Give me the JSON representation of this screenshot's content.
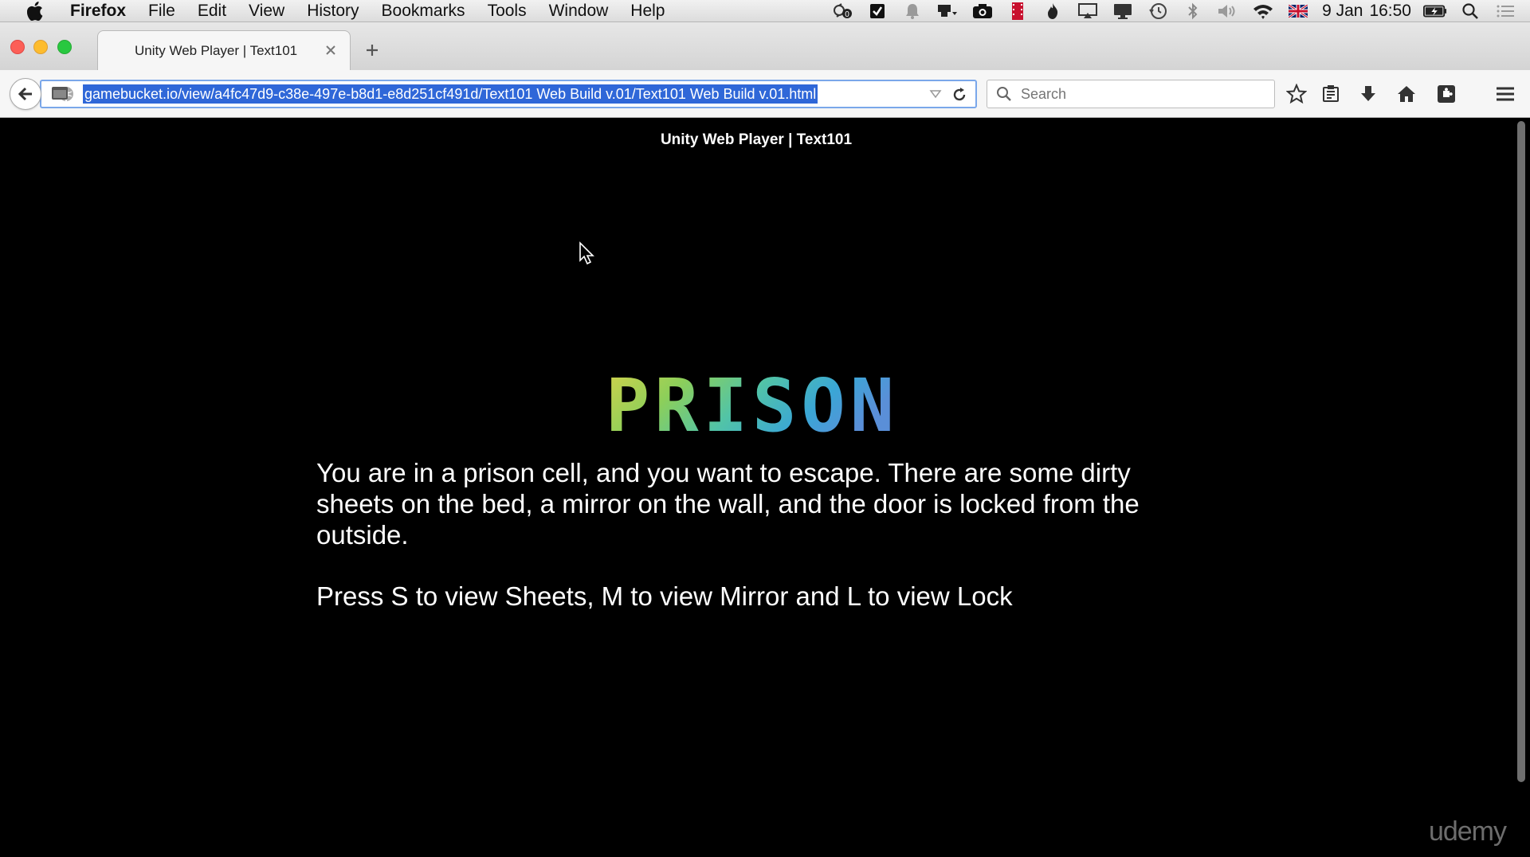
{
  "menubar": {
    "app_name": "Firefox",
    "items": [
      "File",
      "Edit",
      "View",
      "History",
      "Bookmarks",
      "Tools",
      "Window",
      "Help"
    ],
    "date": "9 Jan",
    "time": "16:50"
  },
  "browser": {
    "tab_title": "Unity Web Player | Text101",
    "url": "gamebucket.io/view/a4fc47d9-c38e-497e-b8d1-e8d251cf491d/Text101 Web Build v.01/Text101 Web Build v.01.html",
    "search_placeholder": "Search"
  },
  "page": {
    "header": "Unity Web Player | Text101",
    "title_logo_text": "PRISON",
    "story": "You are in a prison cell, and you want to escape. There are some dirty sheets on the bed, a mirror on the wall, and the door is locked from the outside.",
    "prompt": "Press S to view Sheets, M to view Mirror and L to view Lock",
    "watermark": "udemy"
  },
  "colors": {
    "urlbar_focus": "#7aa7ea",
    "url_selection": "#2f67d8",
    "page_background": "#000000"
  }
}
